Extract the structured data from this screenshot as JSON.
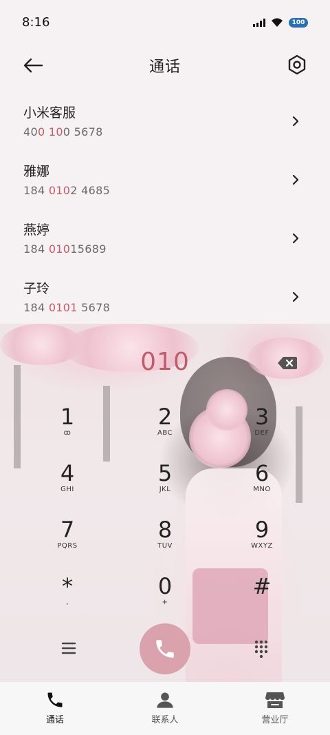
{
  "status_bar": {
    "time": "8:16",
    "battery": "100",
    "icons": [
      "signal-icon",
      "wifi-icon",
      "battery-icon"
    ]
  },
  "header": {
    "title": "通话",
    "back_icon": "back-arrow-icon",
    "settings_icon": "settings-hexagon-icon"
  },
  "contacts": [
    {
      "name": "小米客服",
      "number_parts": [
        "40",
        "0 10",
        "0 5678"
      ]
    },
    {
      "name": "雅娜",
      "number_parts": [
        "184 ",
        "010",
        "2 4685"
      ]
    },
    {
      "name": "燕婷",
      "number_parts": [
        "184 ",
        "010",
        "15689"
      ]
    },
    {
      "name": "子玲",
      "number_parts": [
        "184 ",
        "0101",
        " 5678"
      ]
    }
  ],
  "dialer": {
    "input": "010",
    "keys": [
      {
        "digit": "1",
        "letters": "ꝏ"
      },
      {
        "digit": "2",
        "letters": "ABC"
      },
      {
        "digit": "3",
        "letters": "DEF"
      },
      {
        "digit": "4",
        "letters": "GHI"
      },
      {
        "digit": "5",
        "letters": "JKL"
      },
      {
        "digit": "6",
        "letters": "MNO"
      },
      {
        "digit": "7",
        "letters": "PQRS"
      },
      {
        "digit": "8",
        "letters": "TUV"
      },
      {
        "digit": "9",
        "letters": "WXYZ"
      },
      {
        "digit": "*",
        "letters": ","
      },
      {
        "digit": "0",
        "letters": "+"
      },
      {
        "digit": "#",
        "letters": ""
      }
    ]
  },
  "tabs": [
    {
      "label": "通话",
      "icon": "phone-icon",
      "active": true
    },
    {
      "label": "联系人",
      "icon": "person-icon",
      "active": false
    },
    {
      "label": "营业厅",
      "icon": "store-icon",
      "active": false
    }
  ],
  "colors": {
    "accent": "#c15a6a",
    "call_button": "#d9a2ad",
    "background": "#f6f1f2"
  }
}
